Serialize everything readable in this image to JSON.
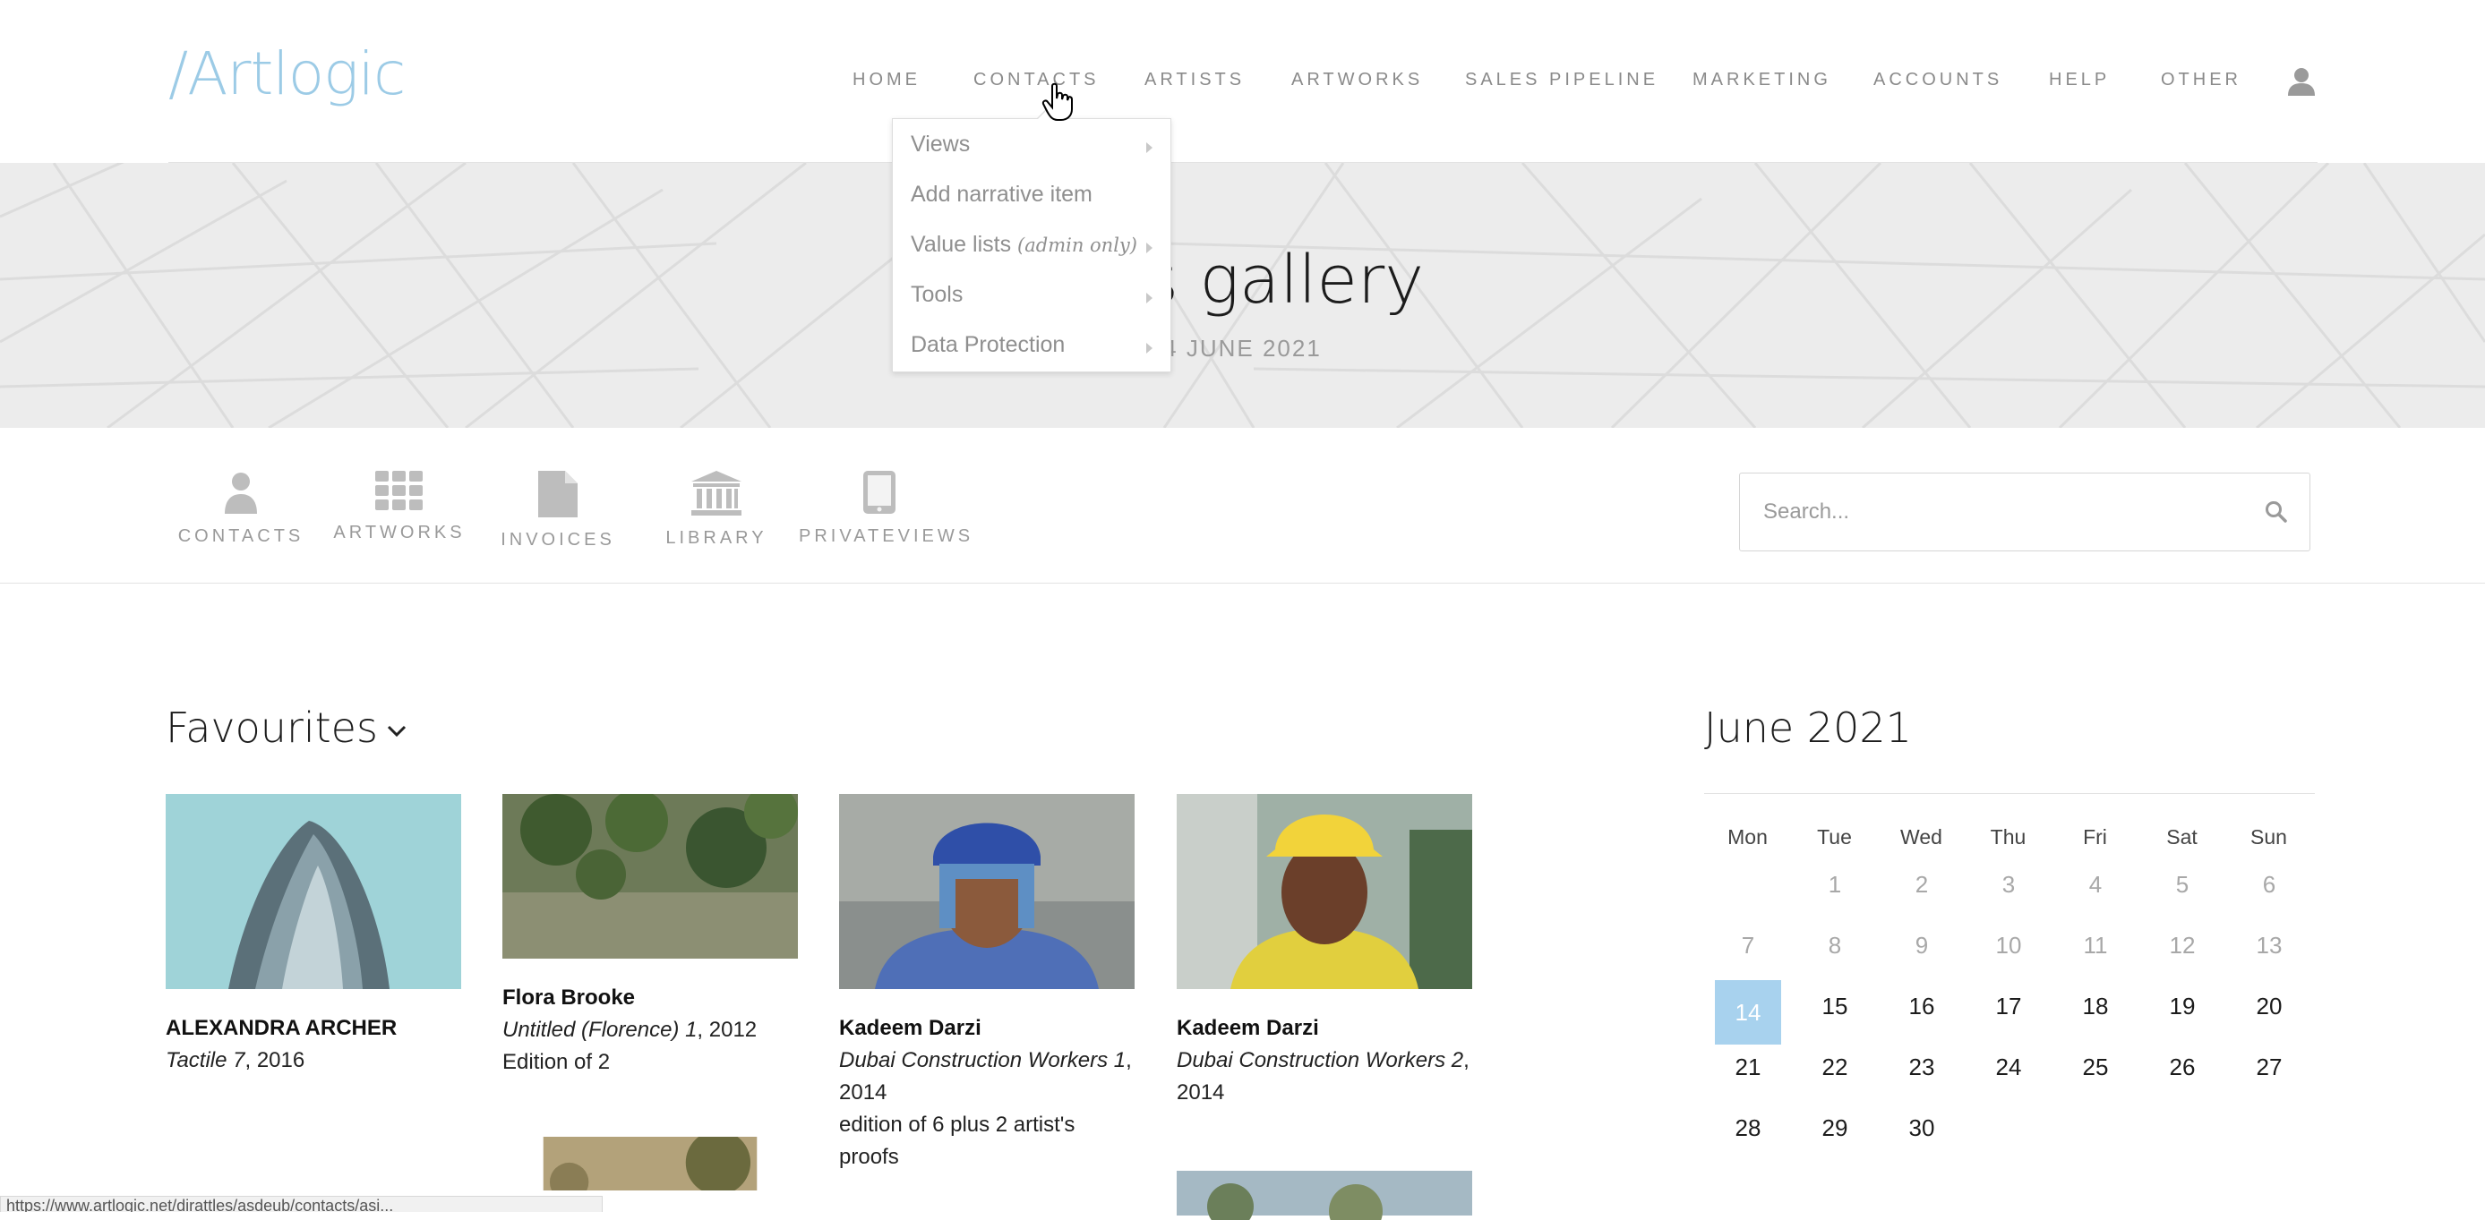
{
  "app": {
    "logo_text": "/Artlogic"
  },
  "nav": {
    "items": [
      "HOME",
      "CONTACTS",
      "ARTISTS",
      "ARTWORKS",
      "SALES PIPELINE",
      "MARKETING",
      "ACCOUNTS",
      "HELP",
      "OTHER"
    ],
    "user_icon": "user-icon"
  },
  "hero": {
    "title": "eus gallery",
    "subtitle": "4 JUNE 2021"
  },
  "contacts_menu": {
    "items": [
      {
        "label": "Views",
        "note": "",
        "has_submenu": true
      },
      {
        "label": "Add narrative item",
        "note": "",
        "has_submenu": false
      },
      {
        "label": "Value lists",
        "note": "(admin only)",
        "has_submenu": true
      },
      {
        "label": "Tools",
        "note": "",
        "has_submenu": true
      },
      {
        "label": "Data Protection",
        "note": "",
        "has_submenu": true
      }
    ]
  },
  "quick_links": [
    {
      "label": "CONTACTS",
      "icon": "person-icon"
    },
    {
      "label": "ARTWORKS",
      "icon": "grid-icon"
    },
    {
      "label": "INVOICES",
      "icon": "document-icon"
    },
    {
      "label": "LIBRARY",
      "icon": "library-icon"
    },
    {
      "label": "PRIVATEVIEWS",
      "icon": "tablet-icon"
    }
  ],
  "search": {
    "placeholder": "Search..."
  },
  "favourites": {
    "title": "Favourites",
    "cards": [
      {
        "artist": "ALEXANDRA ARCHER",
        "title": "Tactile 7",
        "year": ", 2016",
        "edition": ""
      },
      {
        "artist": "Flora Brooke",
        "title": "Untitled (Florence) 1",
        "year": ", 2012",
        "edition": "Edition of 2"
      },
      {
        "artist": "Kadeem Darzi",
        "title": "Dubai Construction Workers 1",
        "year": ", 2014",
        "edition": "edition of 6 plus 2 artist's proofs"
      },
      {
        "artist": "Kadeem Darzi",
        "title": "Dubai Construction Workers 2",
        "year": ", 2014",
        "edition": ""
      }
    ]
  },
  "calendar": {
    "title": "June 2021",
    "weekdays": [
      "Mon",
      "Tue",
      "Wed",
      "Thu",
      "Fri",
      "Sat",
      "Sun"
    ],
    "days": [
      "1",
      "2",
      "3",
      "4",
      "5",
      "6",
      "7",
      "8",
      "9",
      "10",
      "11",
      "12",
      "13",
      "14",
      "15",
      "16",
      "17",
      "18",
      "19",
      "20",
      "21",
      "22",
      "23",
      "24",
      "25",
      "26",
      "27",
      "28",
      "29",
      "30"
    ],
    "today": "14"
  },
  "status_bar": {
    "text": "https://www.artlogic.net/dirattles/asdeub/contacts/asi..."
  },
  "colors": {
    "accent": "#a8d2ee",
    "logo": "#9ccbe6",
    "nav_text": "#8a8a8a",
    "hero_bg": "#ececec"
  }
}
